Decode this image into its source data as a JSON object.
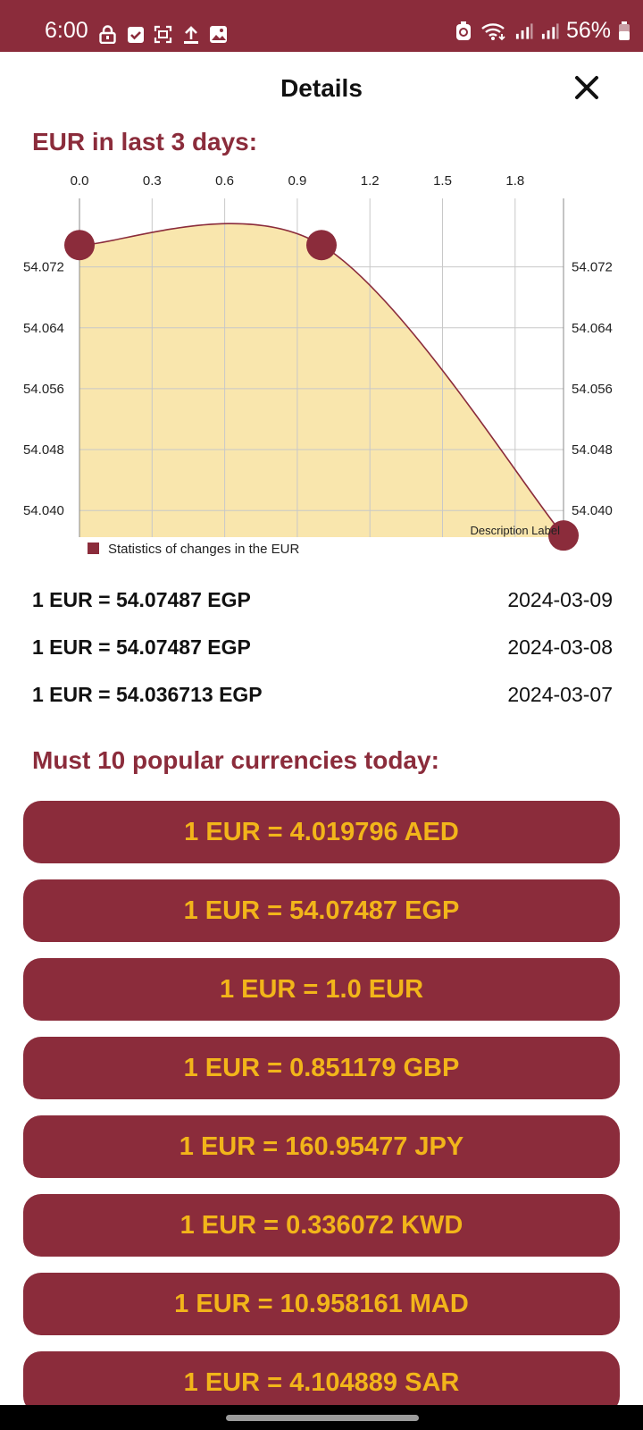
{
  "status_bar": {
    "time": "6:00",
    "battery": "56%",
    "left_icons": [
      "lock-icon",
      "checkbox-icon",
      "screenshot-icon",
      "upload-icon",
      "gallery-icon"
    ],
    "right_icons": [
      "battery-saver-icon",
      "wifi-icon",
      "signal-icon",
      "signal-icon",
      "battery-icon"
    ]
  },
  "header": {
    "title": "Details",
    "close_icon": "close-icon"
  },
  "history": {
    "title": "EUR in last 3 days:"
  },
  "chart_data": {
    "type": "line",
    "x": [
      0,
      1,
      2
    ],
    "y": [
      54.07487,
      54.07487,
      54.036713
    ],
    "x_ticks": [
      "0.0",
      "0.3",
      "0.6",
      "0.9",
      "1.2",
      "1.5",
      "1.8"
    ],
    "y_ticks": [
      "54.040",
      "54.048",
      "54.056",
      "54.064",
      "54.072"
    ],
    "xlim": [
      0,
      2
    ],
    "ylim": [
      54.0365,
      54.081
    ],
    "fill": true,
    "grid": true,
    "legend": "bottom-left",
    "series": [
      {
        "name": "Statistics of changes in the EUR"
      }
    ],
    "description": "Description Label",
    "colors": {
      "line": "#8b2c3b",
      "fill": "#f9e6ad",
      "marker": "#8b2c3b",
      "grid": "#c8c8c8"
    }
  },
  "rates": [
    {
      "text": "1 EUR = 54.07487 EGP",
      "date": "2024-03-09"
    },
    {
      "text": "1 EUR = 54.07487 EGP",
      "date": "2024-03-08"
    },
    {
      "text": "1 EUR = 54.036713 EGP",
      "date": "2024-03-07"
    }
  ],
  "popular": {
    "title": "Must 10 popular currencies today:",
    "items": [
      "1 EUR = 4.019796 AED",
      "1 EUR = 54.07487 EGP",
      "1 EUR = 1.0 EUR",
      "1 EUR = 0.851179 GBP",
      "1 EUR = 160.95477 JPY",
      "1 EUR = 0.336072 KWD",
      "1 EUR = 10.958161 MAD",
      "1 EUR = 4.104889 SAR"
    ]
  },
  "colors": {
    "brand": "#8b2c3b",
    "button_text": "#f2b51a"
  }
}
